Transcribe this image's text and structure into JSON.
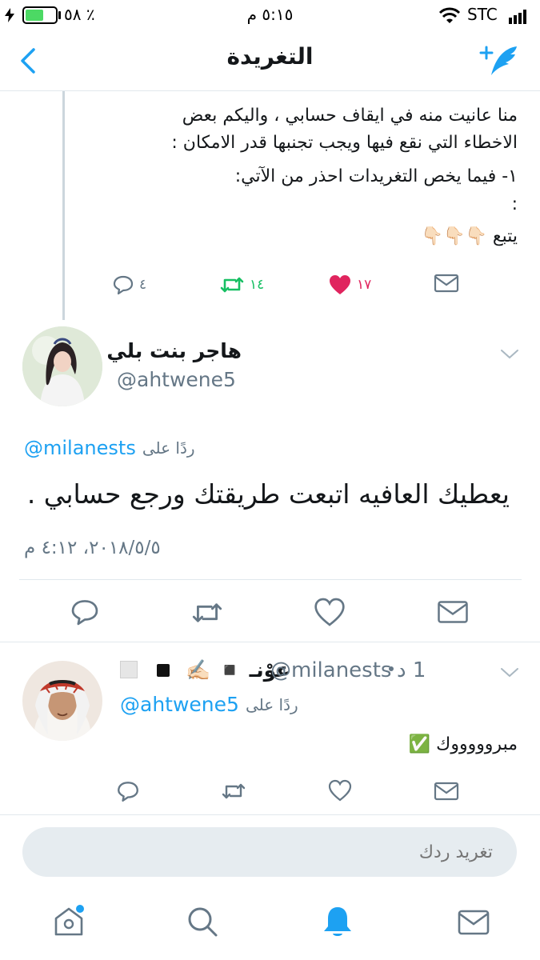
{
  "status_bar": {
    "battery_percent": "٥٨ ٪",
    "time": "٥:١٥ م",
    "carrier": "STC"
  },
  "nav": {
    "title": "التغريدة"
  },
  "parent_tweet": {
    "lines": [
      "منا عانيت منه في ايقاف حسابي ، واليكم بعض",
      "الاخطاء التي نقع فيها ويجب تجنبها قدر الامكان :",
      "١- فيما يخص التغريدات احذر من الآتي:",
      ":",
      "يتبع 👇🏻👇🏻👇🏻"
    ],
    "reply_count": "٤",
    "retweet_count": "١٤",
    "like_count": "١٧"
  },
  "main_tweet": {
    "display_name": "هاجر بنت بلي",
    "handle": "@ahtwene5",
    "replying_prefix": "ردًا على",
    "replying_to": "@milanests",
    "text": "يعطيك العافيه اتبعت طريقتك ورجع حسابي .",
    "timestamp": "٢٠١٨/٥/٥، ٤:١٢ م"
  },
  "reply_tweet": {
    "display_name": "عوْنـ ◾️ ✍🏻",
    "handle": "@milanests",
    "time_ago": "1 د",
    "replying_prefix": "ردًا على",
    "replying_to": "@ahtwene5",
    "text": "مبروووووك ✅"
  },
  "compose": {
    "placeholder": "تغريد ردك"
  },
  "colors": {
    "accent": "#1da1f2",
    "retweet_green": "#17bf63",
    "like_red": "#e0245e",
    "icon_gray": "#657786",
    "divider": "#e1e8ed"
  },
  "tab_bar": {
    "items": [
      "home-icon",
      "search-icon",
      "notifications-icon",
      "messages-icon"
    ],
    "active": "notifications-icon"
  }
}
